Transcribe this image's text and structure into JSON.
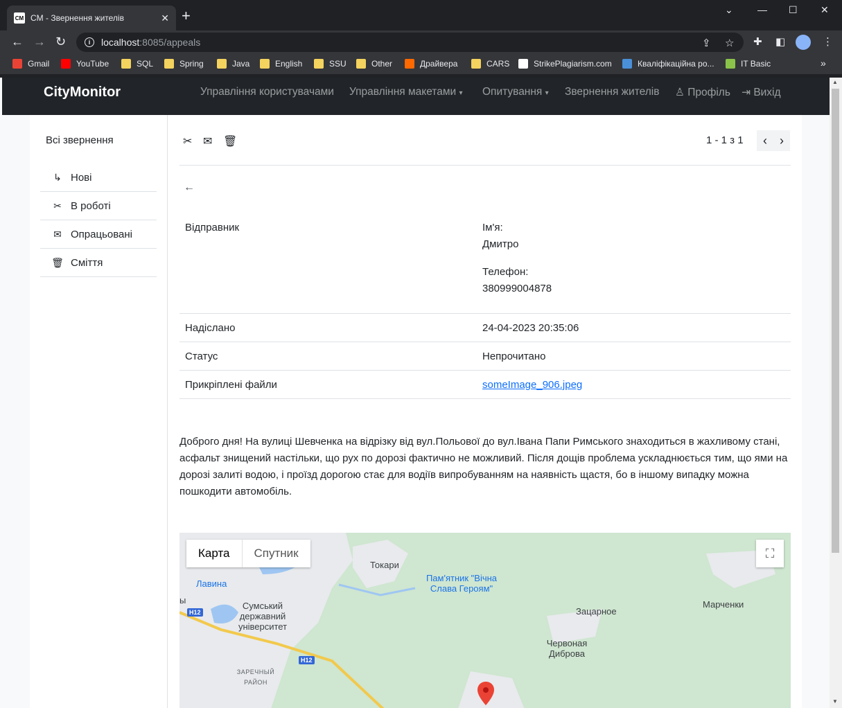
{
  "browser": {
    "tab_title": "CM - Звернення жителів",
    "favicon_text": "CM",
    "url_host": "localhost",
    "url_rest": ":8085/appeals",
    "bookmarks": [
      {
        "label": "Gmail",
        "icon": "gmail-icon"
      },
      {
        "label": "YouTube",
        "icon": "youtube-icon"
      },
      {
        "label": "SQL",
        "icon": "folder-icon"
      },
      {
        "label": "Spring",
        "icon": "folder-icon"
      },
      {
        "label": "Java",
        "icon": "folder-icon"
      },
      {
        "label": "English",
        "icon": "folder-icon"
      },
      {
        "label": "SSU",
        "icon": "folder-icon"
      },
      {
        "label": "Other",
        "icon": "folder-icon"
      },
      {
        "label": "Драйвера",
        "icon": "xiaomi-icon"
      },
      {
        "label": "CARS",
        "icon": "folder-icon"
      },
      {
        "label": "StrikePlagiarism.com",
        "icon": "strikeplagiarism-icon"
      },
      {
        "label": "Кваліфікаційна ро...",
        "icon": "ua-icon"
      },
      {
        "label": "IT Basic",
        "icon": "itbasic-icon"
      }
    ],
    "bookmarks_more": "»"
  },
  "navbar": {
    "brand": "CityMonitor",
    "links": {
      "users": "Управління користувачами",
      "layouts": "Управління макетами",
      "polls": "Опитування",
      "appeals": "Звернення жителів",
      "profile": "Профіль",
      "logout": "Вихід"
    }
  },
  "sidebar": {
    "title": "Всі звернення",
    "items": [
      {
        "label": "Нові",
        "icon": "↳"
      },
      {
        "label": "В роботі",
        "icon": "✂"
      },
      {
        "label": "Опрацьовані",
        "icon": "✉"
      },
      {
        "label": "Сміття",
        "icon": "🗑"
      }
    ]
  },
  "toolbar": {
    "pager_text": "1 - 1 з 1",
    "icons": [
      "tools-icon",
      "envelope-check-icon",
      "trash-icon"
    ]
  },
  "appeal": {
    "sender_label": "Відправник",
    "name_label": "Ім'я:",
    "name_value": "Дмитро",
    "phone_label": "Телефон:",
    "phone_value": "380999004878",
    "sent_label": "Надіслано",
    "sent_value": "24-04-2023 20:35:06",
    "status_label": "Статус",
    "status_value": "Непрочитано",
    "files_label": "Прикріплені файли",
    "file_name": "someImage_906.jpeg",
    "message": "Доброго дня! На вулиці Шевченка на відрізку від вул.Польової до вул.Івана Папи Римського знаходиться в жахливому стані, асфальт знищений настільки, що рух по дорозі фактично не можливий. Після дощів проблема ускладнюється тим, що ями на дорозі залиті водою, і проїзд дорогою стає для водіїв випробуванням на наявність щастя, бо в іншому випадку можна пошкодити автомобіль."
  },
  "map": {
    "type_map": "Карта",
    "type_satellite": "Спутник",
    "labels": {
      "tokari": "Токари",
      "monument": "Пам'ятник \"Вічна Слава Героям\"",
      "lavina": "Лавина",
      "university": "Сумський державний університет",
      "zatsarnoe": "Зацарное",
      "marchenki": "Марченки",
      "chervonaya": "Червоная Диброва",
      "zarechny": "ЗАРЕЧНЫЙ РАЙОН",
      "edge": "ы"
    },
    "road_shield": "H12",
    "colors": {
      "land": "#cfe6d0",
      "urban": "#e8eaed",
      "water": "#9fc6f2",
      "road": "#f2c94c",
      "marker": "#ea4335"
    }
  }
}
